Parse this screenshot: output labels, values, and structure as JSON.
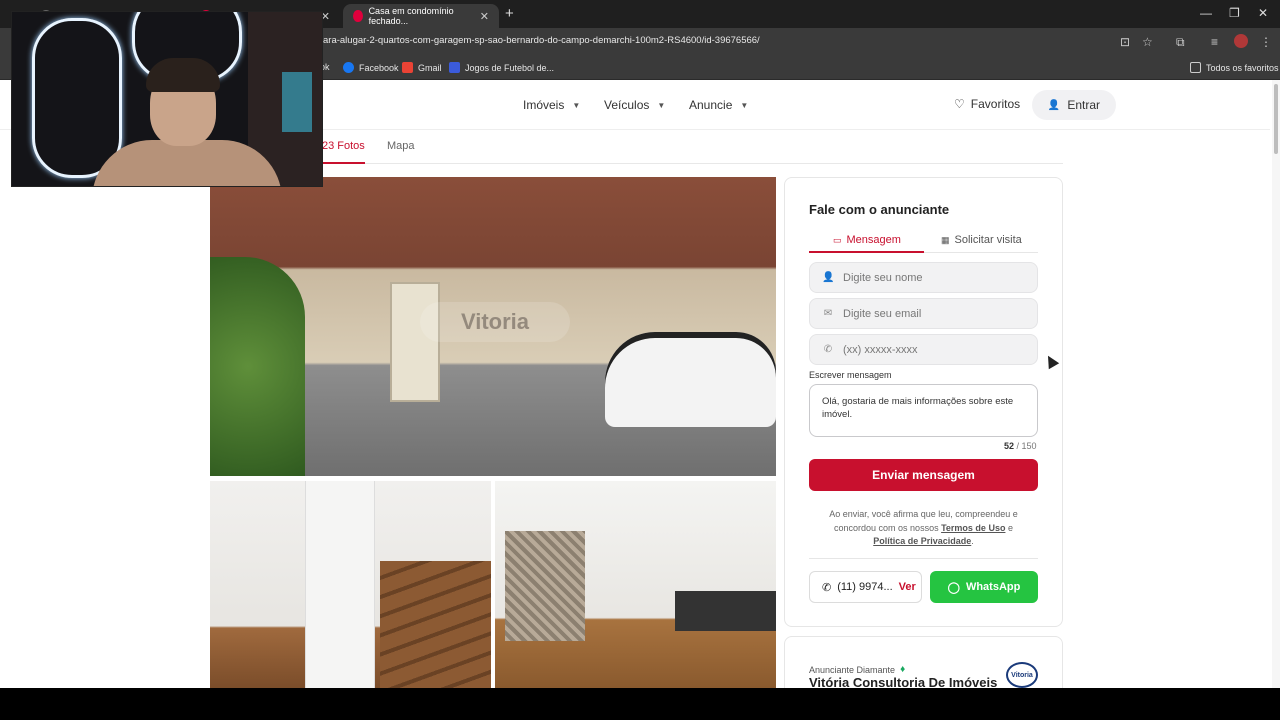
{
  "browser": {
    "tabs": [
      {
        "label": "Casa em condomínio fechado..."
      }
    ],
    "url": "ara-alugar-2-quartos-com-garagem-sp-sao-bernardo-do-campo-demarchi-100m2-RS4600/id-39676566/",
    "bookmarks": [
      {
        "label": "ok"
      },
      {
        "label": "Facebook"
      },
      {
        "label": "Gmail"
      },
      {
        "label": "Jogos de Futebol de..."
      }
    ],
    "all_bookmarks": "Todos os favoritos"
  },
  "header": {
    "nav": [
      {
        "label": "Imóveis"
      },
      {
        "label": "Veículos"
      },
      {
        "label": "Anuncie"
      }
    ],
    "favoritos": "Favoritos",
    "entrar": "Entrar"
  },
  "subtabs": {
    "fotos": "23 Fotos",
    "mapa": "Mapa"
  },
  "photos": {
    "watermark": "Vitoria"
  },
  "contact": {
    "title": "Fale com o anunciante",
    "tab_mensagem": "Mensagem",
    "tab_visita": "Solicitar visita",
    "name_placeholder": "Digite seu nome",
    "email_placeholder": "Digite seu email",
    "phone_placeholder": "(xx) xxxxx-xxxx",
    "message_label": "Escrever mensagem",
    "message_text": "Olá, gostaria de mais informações sobre este imóvel.",
    "char_count": "52",
    "char_max": "/ 150",
    "send_label": "Enviar mensagem",
    "terms_prefix": "Ao enviar, você afirma que leu, compreendeu e concordou com os nossos",
    "terms_link": "Termos de Uso",
    "terms_and": "e",
    "privacy_link": "Política de Privacidade",
    "phone_partial": "(11) 9974...",
    "phone_ver": "Ver",
    "whatsapp_label": "WhatsApp"
  },
  "advertiser": {
    "type": "Anunciante Diamante",
    "name": "Vitória Consultoria De Imóveis",
    "logo_text": "Vitoria"
  }
}
